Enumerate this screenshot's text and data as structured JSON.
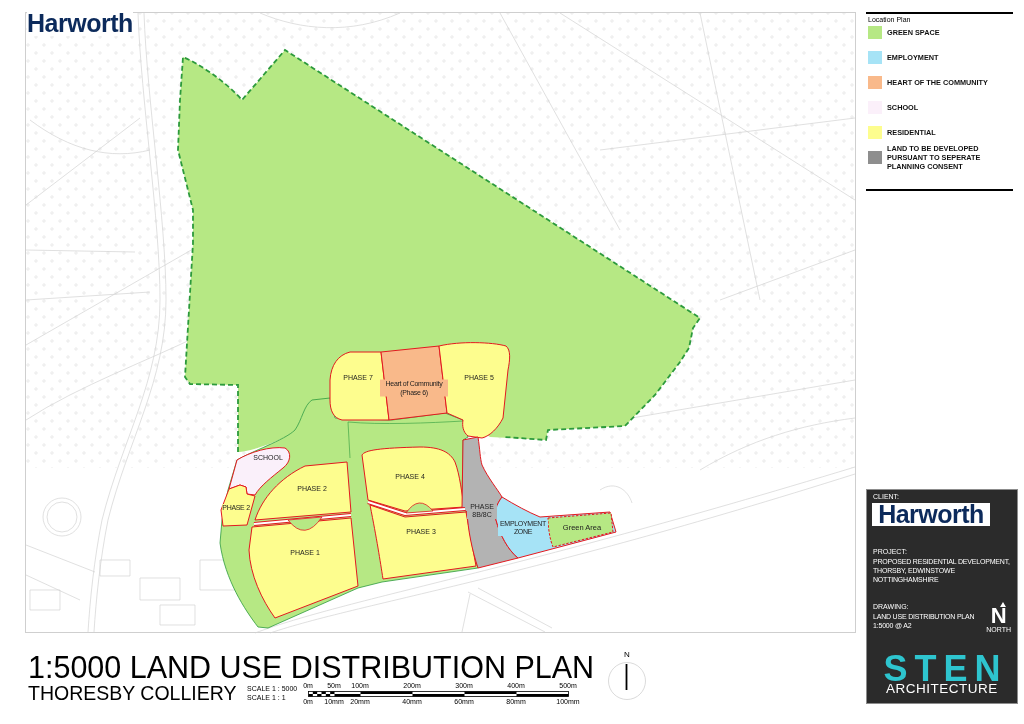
{
  "logo": {
    "text": "Harworth"
  },
  "map": {
    "areas": [
      {
        "label": "PHASE 7",
        "kind": "residential"
      },
      {
        "label": "Heart of Community (Phase 6)",
        "kind": "community"
      },
      {
        "label": "PHASE 5",
        "kind": "residential"
      },
      {
        "label": "SCHOOL",
        "kind": "school"
      },
      {
        "label": "PHASE 2",
        "kind": "residential"
      },
      {
        "label": "PHASE 2",
        "kind": "residential"
      },
      {
        "label": "PHASE 4",
        "kind": "residential"
      },
      {
        "label": "PHASE 1",
        "kind": "residential"
      },
      {
        "label": "PHASE 3",
        "kind": "residential"
      },
      {
        "label": "PHASE 8B/8C",
        "kind": "consented"
      },
      {
        "label": "EMPLOYMENT ZONE",
        "kind": "employment"
      },
      {
        "label": "Green Area",
        "kind": "green_area"
      }
    ]
  },
  "plan_title": "1:5000 LAND USE DISTRIBUTION PLAN",
  "site_name": "THORESBY COLLIERY",
  "scale": {
    "ratios": [
      "SCALE 1 : 5000",
      "SCALE 1 : 1"
    ],
    "distance_ticks": [
      "0m",
      "50m",
      "100m",
      "200m",
      "300m",
      "400m",
      "500m"
    ],
    "paper_ticks": [
      "0m",
      "10mm",
      "20mm",
      "40mm",
      "60mm",
      "80mm",
      "100mm"
    ]
  },
  "compass": {
    "letter": "N"
  },
  "legend": {
    "title": "Location Plan",
    "items": [
      {
        "label": "GREEN SPACE",
        "color": "#b6e884"
      },
      {
        "label": "EMPLOYMENT",
        "color": "#a6e3f6"
      },
      {
        "label": "HEART OF THE COMMUNITY",
        "color": "#f9b98a"
      },
      {
        "label": "SCHOOL",
        "color": "#fbf0fa"
      },
      {
        "label": "RESIDENTIAL",
        "color": "#fdfd8e"
      },
      {
        "label": "LAND TO BE DEVELOPED PURSUANT TO SEPERATE PLANNING CONSENT",
        "color": "#8e8e8e"
      }
    ]
  },
  "title_block": {
    "client_caption": "CLIENT:",
    "client_logo": "Harworth",
    "project_caption": "PROJECT:",
    "project_lines": [
      "PROPOSED RESIDENTIAL DEVELOPMENT,",
      "THORSBY, EDWINSTOWE",
      "NOTTINGHAMSHIRE"
    ],
    "drawing_caption": "DRAWING:",
    "drawing_lines": [
      "LAND USE DISTRIBUTION PLAN",
      "1:5000 @ A2"
    ],
    "north_letter": "N",
    "north_label": "NORTH",
    "architect_logo": "STEN",
    "architect_tagline": "ARCHITECTURE"
  }
}
